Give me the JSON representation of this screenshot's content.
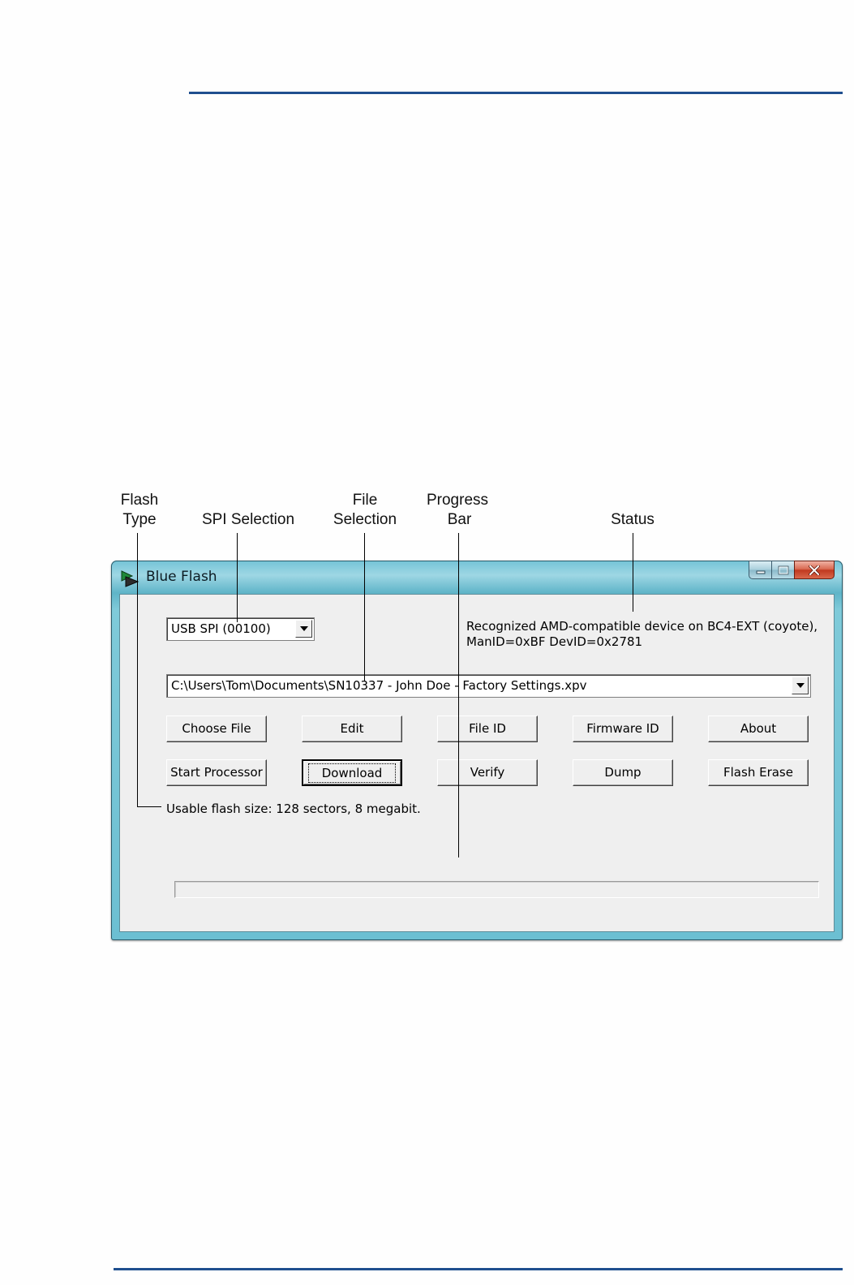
{
  "callouts": {
    "flash_type": [
      "Flash",
      "Type"
    ],
    "spi_selection": "SPI Selection",
    "file_selection": [
      "File",
      "Selection"
    ],
    "progress_bar": [
      "Progress",
      "Bar"
    ],
    "status": "Status"
  },
  "window": {
    "title": "Blue Flash",
    "icon": "blue-flash-app-icon"
  },
  "spi_combo": {
    "value": "USB SPI (00100)"
  },
  "status_text": {
    "line1": "Recognized AMD-compatible device on BC4-EXT (coyote),",
    "line2": "ManID=0xBF DevID=0x2781"
  },
  "file_combo": {
    "value": "C:\\Users\\Tom\\Documents\\SN10337 - John Doe - Factory Settings.xpv"
  },
  "buttons": {
    "row1": [
      "Choose File",
      "Edit",
      "File ID",
      "Firmware ID",
      "About"
    ],
    "row2": [
      "Start Processor",
      "Download",
      "Verify",
      "Dump",
      "Flash Erase"
    ]
  },
  "flash_size_text": "Usable flash size: 128 sectors, 8 megabit.",
  "progress": {
    "fraction": 0
  },
  "colors": {
    "rule": "#1f4f8f",
    "frame": "#6cbfd2",
    "client": "#efefef"
  }
}
